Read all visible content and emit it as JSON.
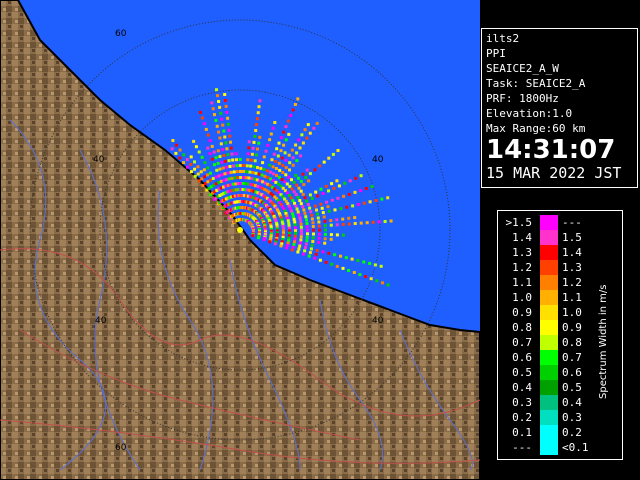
{
  "map": {
    "range_labels": [
      "60",
      "40",
      "40",
      "40",
      "40",
      "60"
    ],
    "colors": {
      "sea": "#1f5fff",
      "land": "#8a6c48",
      "coast": "#000000",
      "rings": "#333333",
      "rivers": "#5a6fd8",
      "boundaries": "#c0504d"
    }
  },
  "info": {
    "station": "ilts2",
    "product": "PPI",
    "scan": "SEAICE2_A_W",
    "task": "Task: SEAICE2_A",
    "prf": "PRF: 1800Hz",
    "elevation": "Elevation:1.0",
    "max_range": "Max Range:60 km",
    "time": "14:31:07",
    "date": "15 MAR 2022 JST"
  },
  "legend": {
    "title": "Spectrum Width in m/s",
    "rows": [
      {
        "low": ">1.5",
        "high": "---",
        "color": "#ff00ff"
      },
      {
        "low": "1.4",
        "high": "1.5",
        "color": "#ff33cc"
      },
      {
        "low": "1.3",
        "high": "1.4",
        "color": "#ff0000"
      },
      {
        "low": "1.2",
        "high": "1.3",
        "color": "#ff4000"
      },
      {
        "low": "1.1",
        "high": "1.2",
        "color": "#ff8000"
      },
      {
        "low": "1.0",
        "high": "1.1",
        "color": "#ffb000"
      },
      {
        "low": "0.9",
        "high": "1.0",
        "color": "#ffe000"
      },
      {
        "low": "0.8",
        "high": "0.9",
        "color": "#ffff00"
      },
      {
        "low": "0.7",
        "high": "0.8",
        "color": "#c0ff00"
      },
      {
        "low": "0.6",
        "high": "0.7",
        "color": "#00ff00"
      },
      {
        "low": "0.5",
        "high": "0.6",
        "color": "#00d000"
      },
      {
        "low": "0.4",
        "high": "0.5",
        "color": "#00a000"
      },
      {
        "low": "0.3",
        "high": "0.4",
        "color": "#00c080"
      },
      {
        "low": "0.2",
        "high": "0.3",
        "color": "#00e0c0"
      },
      {
        "low": "0.1",
        "high": "0.2",
        "color": "#00ffff"
      },
      {
        "low": "---",
        "high": "<0.1",
        "color": "#00ffff"
      }
    ]
  }
}
